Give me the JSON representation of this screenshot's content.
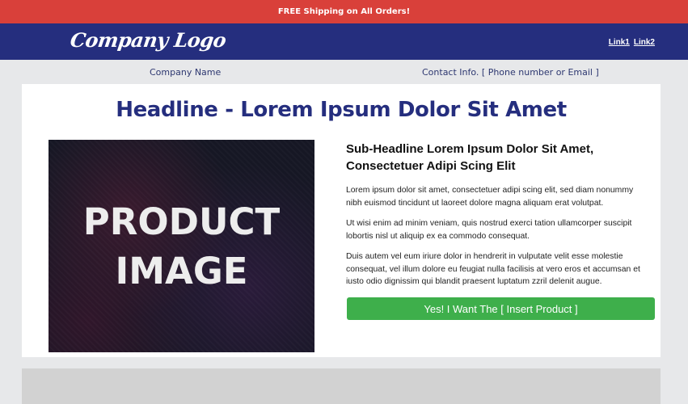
{
  "announcement": {
    "text": "FREE Shipping on All Orders!"
  },
  "header": {
    "logo_text": "Company Logo",
    "links": [
      "Link1",
      "Link2"
    ]
  },
  "info": {
    "company_name": "Company Name",
    "contact_info": "Contact Info. [ Phone number or Email ]"
  },
  "main": {
    "headline": "Headline - Lorem Ipsum Dolor Sit Amet",
    "product_image_text": "PRODUCT IMAGE",
    "subheadline": "Sub-Headline Lorem Ipsum Dolor Sit Amet, Consectetuer Adipi Scing Elit",
    "paragraphs": [
      "Lorem ipsum dolor sit amet, consectetuer adipi scing elit, sed diam nonummy nibh euismod tincidunt ut laoreet dolore magna aliquam erat volutpat.",
      "Ut wisi enim ad minim veniam, quis nostrud exerci tation ullamcorper suscipit lobortis nisl ut aliquip ex ea commodo consequat.",
      "Duis autem vel eum iriure dolor in hendrerit in vulputate velit esse molestie consequat, vel illum dolore eu feugiat nulla facilisis at vero eros et accumsan et iusto odio dignissim qui blandit praesent luptatum zzril delenit augue."
    ],
    "cta_label": "Yes! I Want The [ Insert Product ]"
  },
  "colors": {
    "announcement_bg": "#d9403a",
    "navbar_bg": "#252e7e",
    "cta_bg": "#3eaf4b",
    "page_bg": "#e7e8ea"
  }
}
